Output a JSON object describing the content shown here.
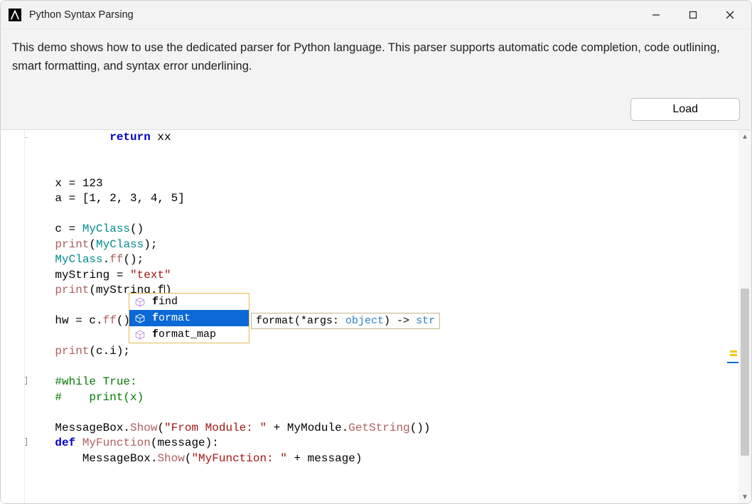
{
  "window": {
    "title": "Python Syntax Parsing"
  },
  "header": {
    "description": "This demo shows how to use the dedicated parser for Python language. This parser supports automatic code completion, code outlining, smart formatting, and syntax error underlining.",
    "load_button": "Load"
  },
  "autocomplete": {
    "items": [
      {
        "match": "f",
        "rest": "ind",
        "full": "find",
        "selected": false
      },
      {
        "match": "f",
        "rest": "ormat",
        "full": "format",
        "selected": true
      },
      {
        "match": "f",
        "rest": "ormat_map",
        "full": "format_map",
        "selected": false
      }
    ],
    "tooltip_raw": "format(*args: object) -> str",
    "tooltip_parts": {
      "pre": "format(*args: ",
      "arg_type": "object",
      "mid": ") -> ",
      "ret_type": "str"
    }
  },
  "scrollbar": {
    "thumb_top_pct": 42,
    "thumb_height_pct": 48
  },
  "minimap": {
    "marks_pct": [
      59,
      60
    ],
    "caret_pct": 62
  },
  "code": {
    "lines": [
      {
        "frag": [
          {
            "cls": "outline-endcap-only",
            "t": ""
          },
          {
            "cls": "pad3",
            "t": "            "
          },
          {
            "cls": "kw",
            "t": "return"
          },
          {
            "cls": "",
            "t": " xx"
          }
        ],
        "outline": "endcap"
      },
      {
        "frag": [
          {
            "cls": "",
            "t": ""
          }
        ]
      },
      {
        "frag": [
          {
            "cls": "",
            "t": ""
          }
        ]
      },
      {
        "frag": [
          {
            "cls": "",
            "t": "    x = "
          },
          {
            "cls": "",
            "t": "123"
          }
        ]
      },
      {
        "frag": [
          {
            "cls": "",
            "t": "    a = [1, 2, 3, 4, 5]"
          }
        ]
      },
      {
        "frag": [
          {
            "cls": "",
            "t": ""
          }
        ]
      },
      {
        "frag": [
          {
            "cls": "",
            "t": "    c = "
          },
          {
            "cls": "cls",
            "t": "MyClass"
          },
          {
            "cls": "",
            "t": "()"
          }
        ]
      },
      {
        "frag": [
          {
            "cls": "",
            "t": "    "
          },
          {
            "cls": "fn",
            "t": "print"
          },
          {
            "cls": "",
            "t": "("
          },
          {
            "cls": "cls",
            "t": "MyClass"
          },
          {
            "cls": "",
            "t": ");"
          }
        ]
      },
      {
        "frag": [
          {
            "cls": "cls",
            "t": "    MyClass"
          },
          {
            "cls": "",
            "t": "."
          },
          {
            "cls": "fn",
            "t": "ff"
          },
          {
            "cls": "",
            "t": "();"
          }
        ],
        "modified": true
      },
      {
        "frag": [
          {
            "cls": "",
            "t": "    myString = "
          },
          {
            "cls": "str",
            "t": "\"text\""
          }
        ],
        "modified": true
      },
      {
        "frag": [
          {
            "cls": "",
            "t": "    "
          },
          {
            "cls": "fn",
            "t": "print"
          },
          {
            "cls": "",
            "t": "(myString.f"
          },
          {
            "cls": "caret",
            "t": ""
          },
          {
            "cls": "",
            "t": ")"
          }
        ],
        "modified": true
      },
      {
        "frag": [
          {
            "cls": "",
            "t": ""
          }
        ]
      },
      {
        "frag": [
          {
            "cls": "",
            "t": "    hw = c."
          },
          {
            "cls": "fn",
            "t": "ff"
          },
          {
            "cls": "",
            "t": "();"
          }
        ]
      },
      {
        "frag": [
          {
            "cls": "",
            "t": ""
          }
        ]
      },
      {
        "frag": [
          {
            "cls": "",
            "t": "    "
          },
          {
            "cls": "fn",
            "t": "print"
          },
          {
            "cls": "",
            "t": "(c.i);"
          }
        ]
      },
      {
        "frag": [
          {
            "cls": "",
            "t": ""
          }
        ]
      },
      {
        "frag": [
          {
            "cls": "",
            "t": "    "
          },
          {
            "cls": "cmt",
            "t": "#while True:"
          }
        ],
        "outline": "box"
      },
      {
        "frag": [
          {
            "cls": "",
            "t": "    "
          },
          {
            "cls": "cmt",
            "t": "#    print(x)"
          }
        ],
        "outline": "vert"
      },
      {
        "frag": [
          {
            "cls": "",
            "t": ""
          }
        ]
      },
      {
        "frag": [
          {
            "cls": "",
            "t": "    MessageBox."
          },
          {
            "cls": "fn",
            "t": "Show"
          },
          {
            "cls": "",
            "t": "("
          },
          {
            "cls": "str",
            "t": "\"From Module: \""
          },
          {
            "cls": "",
            "t": " + MyModule."
          },
          {
            "cls": "fn",
            "t": "GetString"
          },
          {
            "cls": "",
            "t": "())"
          }
        ]
      },
      {
        "frag": [
          {
            "cls": "",
            "t": "    "
          },
          {
            "cls": "kw",
            "t": "def"
          },
          {
            "cls": "",
            "t": " "
          },
          {
            "cls": "fn",
            "t": "MyFunction"
          },
          {
            "cls": "",
            "t": "(message):"
          }
        ],
        "outline": "box"
      },
      {
        "frag": [
          {
            "cls": "",
            "t": "        MessageBox."
          },
          {
            "cls": "fn",
            "t": "Show"
          },
          {
            "cls": "",
            "t": "("
          },
          {
            "cls": "str",
            "t": "\"MyFunction: \""
          },
          {
            "cls": "",
            "t": " + message)"
          }
        ],
        "outline": "vert"
      }
    ]
  }
}
